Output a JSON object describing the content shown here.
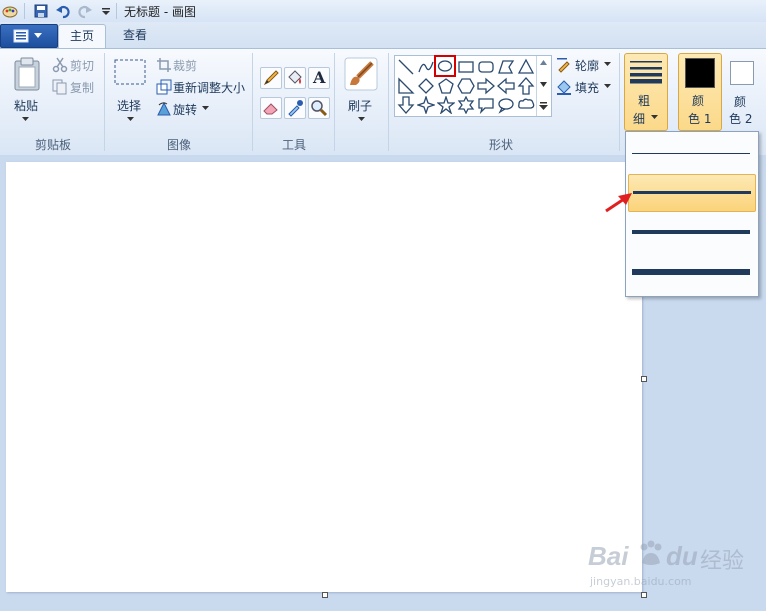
{
  "window": {
    "title": "无标题 - 画图"
  },
  "tabs": [
    {
      "label": "主页"
    },
    {
      "label": "查看"
    }
  ],
  "clipboard": {
    "paste_label": "粘贴",
    "cut_label": "剪切",
    "copy_label": "复制",
    "group_label": "剪贴板"
  },
  "image": {
    "select_label": "选择",
    "crop_label": "裁剪",
    "resize_label": "重新调整大小",
    "rotate_label": "旋转",
    "group_label": "图像"
  },
  "tools": {
    "group_label": "工具",
    "text_tool_glyph": "A"
  },
  "brushes": {
    "label": "刷子"
  },
  "shapes": {
    "outline_label": "轮廓",
    "fill_label": "填充",
    "group_label": "形状",
    "selected_shape": "oval"
  },
  "size": {
    "label_line1": "粗",
    "label_line2": "细"
  },
  "color1": {
    "label_line1": "颜",
    "label_line2": "色 1",
    "value": "#000000"
  },
  "color2": {
    "label_line1": "颜",
    "label_line2": "色 2",
    "value": "#ffffff"
  },
  "size_options": [
    {
      "level": 1
    },
    {
      "level": 2,
      "selected": true
    },
    {
      "level": 3
    },
    {
      "level": 4
    }
  ],
  "watermark": {
    "brand": "Bai",
    "brand_suffix": "du",
    "text": "经验",
    "url": "jingyan.baidu.com"
  },
  "colors": {
    "accent_highlight": "#fbd98a",
    "selection_red": "#d40000",
    "arrow_red": "#e02020",
    "line_color": "#1f3a5a"
  }
}
